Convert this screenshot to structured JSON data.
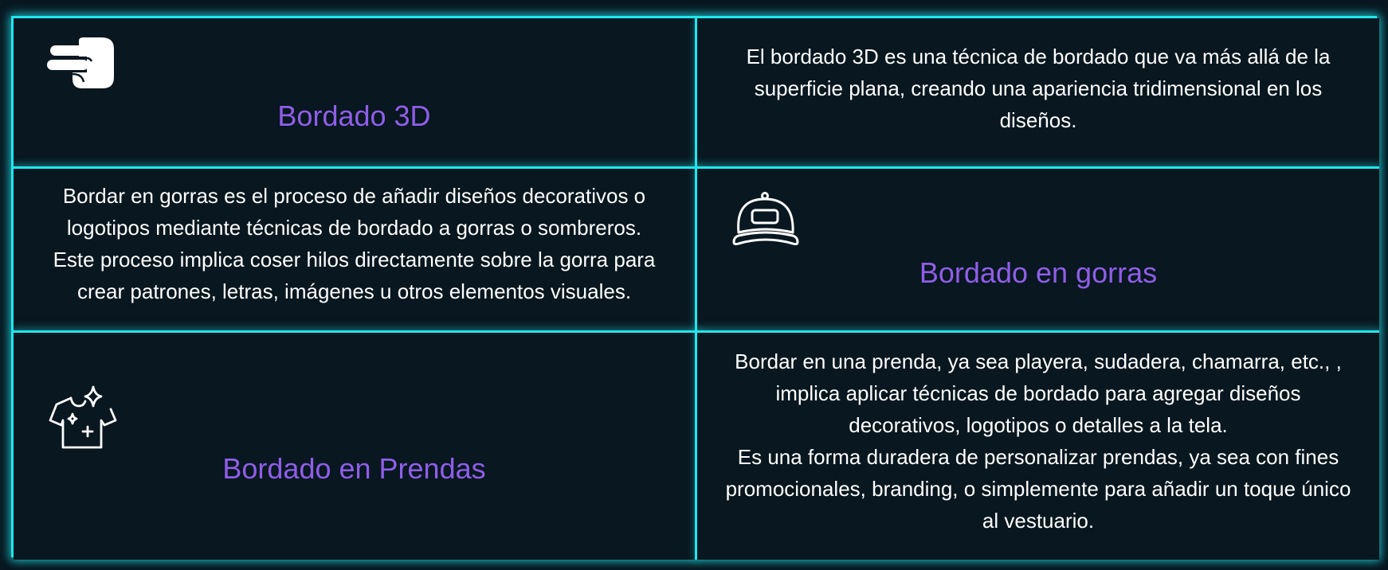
{
  "colors": {
    "background": "#081720",
    "border": "#22e6ee",
    "title": "#8f5ee8",
    "text": "#ffffff"
  },
  "services": {
    "bordado_3d": {
      "icon": "hand-peace-icon",
      "title": "Bordado 3D",
      "description": "El bordado 3D es una técnica de bordado que va más allá de la superficie plana, creando una apariencia tridimensional en los diseños."
    },
    "gorras": {
      "icon": "cap-icon",
      "title": "Bordado en gorras",
      "description_lines": [
        "Bordar en gorras es el proceso de añadir diseños decorativos o logotipos mediante técnicas de bordado a gorras o sombreros.",
        "Este proceso implica coser hilos directamente sobre la gorra para crear patrones, letras, imágenes u otros elementos visuales."
      ]
    },
    "prendas": {
      "icon": "shirt-sparkle-icon",
      "title": "Bordado en Prendas",
      "description_lines": [
        "Bordar en una prenda, ya sea playera, sudadera, chamarra, etc., , implica aplicar técnicas de bordado para agregar diseños decorativos, logotipos o detalles a la tela.",
        "Es una forma duradera de personalizar prendas, ya sea con fines promocionales, branding, o simplemente para añadir un toque único al vestuario."
      ]
    }
  }
}
